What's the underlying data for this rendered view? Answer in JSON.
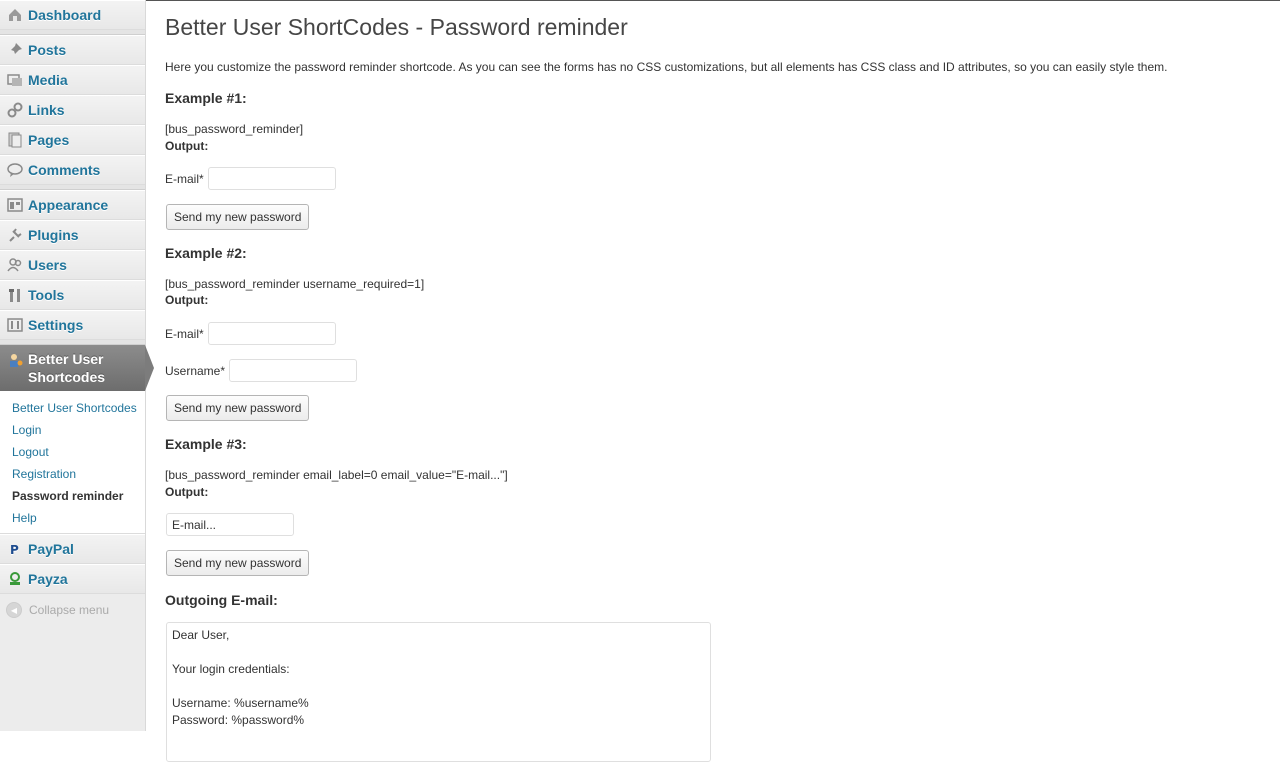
{
  "sidebar": {
    "items": [
      {
        "label": "Dashboard",
        "icon": "dashboard-icon"
      },
      {
        "label": "Posts",
        "icon": "pin-icon"
      },
      {
        "label": "Media",
        "icon": "media-icon"
      },
      {
        "label": "Links",
        "icon": "link-icon"
      },
      {
        "label": "Pages",
        "icon": "pages-icon"
      },
      {
        "label": "Comments",
        "icon": "comment-icon"
      },
      {
        "label": "Appearance",
        "icon": "appearance-icon"
      },
      {
        "label": "Plugins",
        "icon": "plugin-icon"
      },
      {
        "label": "Users",
        "icon": "users-icon"
      },
      {
        "label": "Tools",
        "icon": "tools-icon"
      },
      {
        "label": "Settings",
        "icon": "settings-icon"
      }
    ],
    "current": {
      "label_line1": "Better User",
      "label_line2": "Shortcodes",
      "icon": "user-shortcodes-icon"
    },
    "submenu": [
      "Better User Shortcodes",
      "Login",
      "Logout",
      "Registration",
      "Password reminder",
      "Help"
    ],
    "after": [
      {
        "label": "PayPal",
        "icon": "paypal-icon"
      },
      {
        "label": "Payza",
        "icon": "payza-icon"
      }
    ],
    "collapse": "Collapse menu"
  },
  "main": {
    "title": "Better User ShortCodes - Password reminder",
    "intro": "Here you customize the password reminder shortcode. As you can see the forms has no CSS customizations, but all elements has CSS class and ID attributes, so you can easily style them.",
    "output_label": "Output:",
    "email_label": "E-mail*",
    "username_label": "Username*",
    "button_label": "Send my new password",
    "examples": [
      {
        "heading": "Example #1:",
        "code": "[bus_password_reminder]"
      },
      {
        "heading": "Example #2:",
        "code": "[bus_password_reminder username_required=1]"
      },
      {
        "heading": "Example #3:",
        "code": "[bus_password_reminder email_label=0 email_value=\"E-mail...\"]",
        "email_value": "E-mail..."
      }
    ],
    "outgoing_heading": "Outgoing E-mail:",
    "email_body": "Dear User,\n\nYour login credentials:\n\nUsername: %username%\nPassword: %password%"
  }
}
